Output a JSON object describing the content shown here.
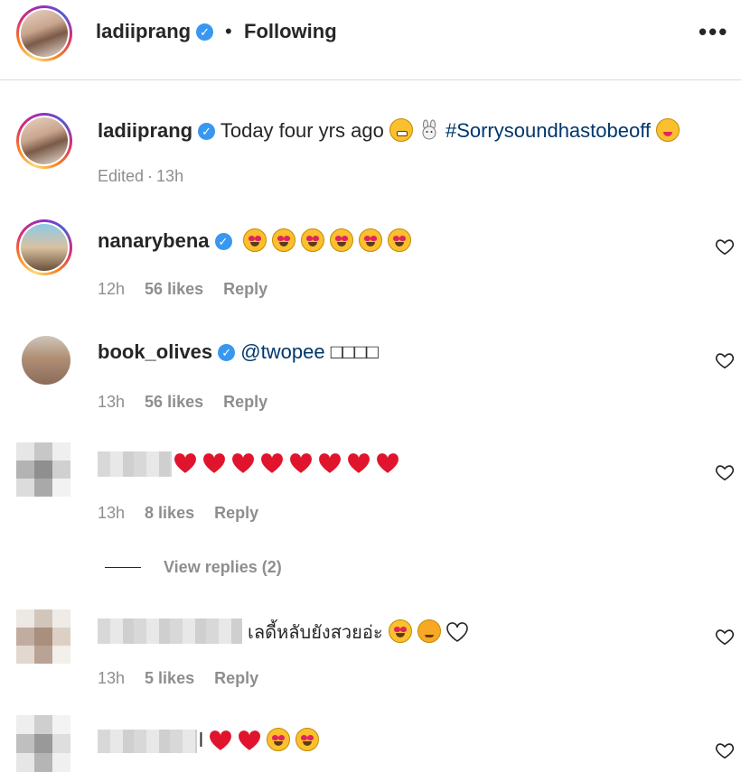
{
  "header": {
    "username": "ladiiprang",
    "separator": "•",
    "follow_status": "Following",
    "more": "•••"
  },
  "caption": {
    "username": "ladiiprang",
    "text": "Today four yrs ago",
    "hashtag": "#Sorrysoundhastobeoff",
    "edited": "Edited",
    "time": "13h"
  },
  "comments": [
    {
      "username": "nanarybena",
      "time": "12h",
      "likes": "56 likes",
      "reply": "Reply"
    },
    {
      "username": "book_olives",
      "mention": "@twopee",
      "tail": "□□□□",
      "time": "13h",
      "likes": "56 likes",
      "reply": "Reply"
    },
    {
      "username": "",
      "time": "13h",
      "likes": "8 likes",
      "reply": "Reply",
      "view_replies": "View replies (2)"
    },
    {
      "username": "",
      "text": "เลดี้หลับยังสวยอ่ะ",
      "time": "13h",
      "likes": "5 likes",
      "reply": "Reply"
    },
    {
      "username": "l"
    }
  ],
  "colors": {
    "verified": "#3897f0",
    "link": "#00376b",
    "meta": "#8e8e8e"
  }
}
